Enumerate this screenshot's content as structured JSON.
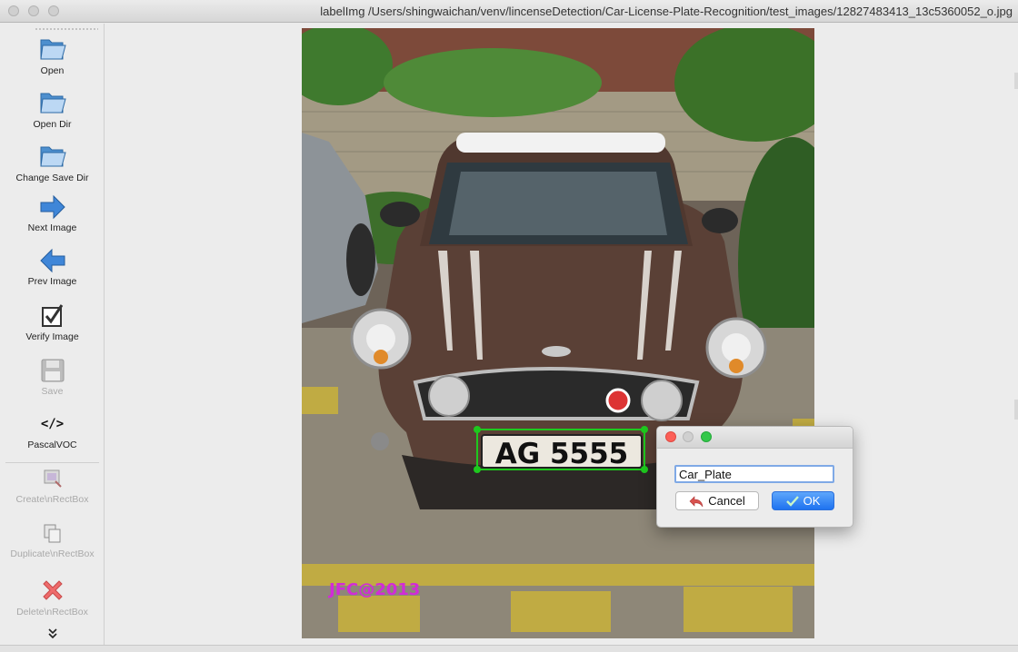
{
  "window": {
    "title": "labelImg /Users/shingwaichan/venv/lincenseDetection/Car-License-Plate-Recognition/test_images/12827483413_13c5360052_o.jpg"
  },
  "toolbar": {
    "items": [
      {
        "label": "Open",
        "icon": "folder-icon",
        "enabled": true
      },
      {
        "label": "Open Dir",
        "icon": "folder-icon",
        "enabled": true
      },
      {
        "label": "Change Save Dir",
        "icon": "folder-icon",
        "enabled": true
      },
      {
        "label": "Next Image",
        "icon": "arrow-right-icon",
        "enabled": true
      },
      {
        "label": "Prev Image",
        "icon": "arrow-left-icon",
        "enabled": true
      },
      {
        "label": "Verify Image",
        "icon": "checkbox-icon",
        "enabled": true
      },
      {
        "label": "Save",
        "icon": "floppy-disk-icon",
        "enabled": false
      },
      {
        "label": "PascalVOC",
        "icon": "code-icon",
        "enabled": true
      },
      {
        "label": "Create\\nRectBox",
        "icon": "create-rect-icon",
        "enabled": false
      },
      {
        "label": "Duplicate\\nRectBox",
        "icon": "duplicate-icon",
        "enabled": false
      },
      {
        "label": "Delete\\nRectBox",
        "icon": "delete-x-icon",
        "enabled": false
      }
    ],
    "overflow_icon": "double-chevron-down-icon",
    "pascal_glyph": "</>"
  },
  "image": {
    "plate_text": "AG 5555",
    "watermark": "JFC@2013",
    "bbox_color": "#1ec81e"
  },
  "dialog": {
    "input_value": "Car_Plate",
    "cancel_label": "Cancel",
    "ok_label": "OK",
    "accent": "#2a7af2"
  }
}
